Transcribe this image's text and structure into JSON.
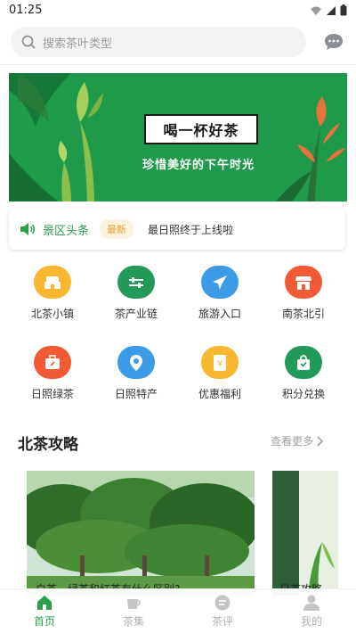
{
  "status_bar": {
    "time": "01:25"
  },
  "search": {
    "placeholder": "搜索茶叶类型"
  },
  "banner": {
    "title": "喝一杯好茶",
    "subtitle": "珍惜美好的下午时光"
  },
  "news": {
    "title": "景区头条",
    "badge": "最新",
    "text": "最日照终于上线啦"
  },
  "grid": [
    {
      "label": "北茶小镇",
      "color": "#f7b731"
    },
    {
      "label": "茶产业链",
      "color": "#239a5a"
    },
    {
      "label": "旅游入口",
      "color": "#3b9be6"
    },
    {
      "label": "南茶北引",
      "color": "#f15a35"
    },
    {
      "label": "日照绿茶",
      "color": "#f15a35"
    },
    {
      "label": "日照特产",
      "color": "#3b9be6"
    },
    {
      "label": "优惠福利",
      "color": "#f7b731"
    },
    {
      "label": "积分兑换",
      "color": "#239a5a"
    }
  ],
  "section": {
    "title": "北茶攻略",
    "more": "查看更多"
  },
  "cards": [
    {
      "caption": "白茶、绿茶和红茶有什么区别?"
    },
    {
      "caption": "日茶攻略"
    }
  ],
  "nav": [
    {
      "label": "首页",
      "active": true
    },
    {
      "label": "茶集",
      "active": false
    },
    {
      "label": "茶评",
      "active": false
    },
    {
      "label": "我的",
      "active": false
    }
  ],
  "colors": {
    "accent": "#2e9e4f",
    "banner_bg": "#1f9a4a",
    "inactive": "#b0b0b0"
  }
}
